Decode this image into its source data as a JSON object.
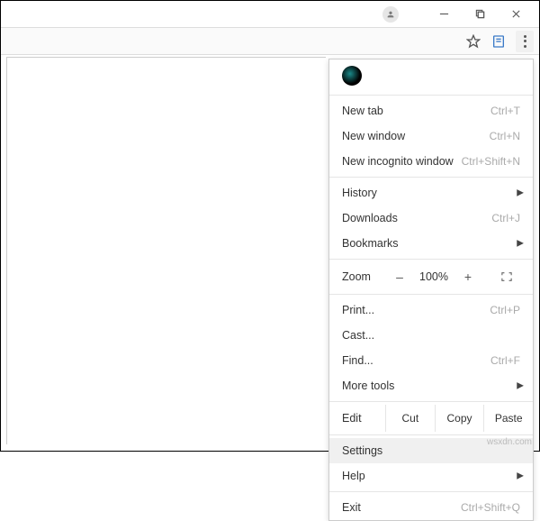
{
  "titlebar": {
    "profile_icon": "profile",
    "minimize": "—",
    "maximize": "□",
    "close": "×"
  },
  "toolbar": {
    "star_icon": "star",
    "note_icon": "note",
    "menu_icon": "kebab"
  },
  "menu": {
    "new_tab": {
      "label": "New tab",
      "shortcut": "Ctrl+T"
    },
    "new_window": {
      "label": "New window",
      "shortcut": "Ctrl+N"
    },
    "new_incognito": {
      "label": "New incognito window",
      "shortcut": "Ctrl+Shift+N"
    },
    "history": {
      "label": "History"
    },
    "downloads": {
      "label": "Downloads",
      "shortcut": "Ctrl+J"
    },
    "bookmarks": {
      "label": "Bookmarks"
    },
    "zoom": {
      "label": "Zoom",
      "minus": "–",
      "value": "100%",
      "plus": "+"
    },
    "print": {
      "label": "Print...",
      "shortcut": "Ctrl+P"
    },
    "cast": {
      "label": "Cast..."
    },
    "find": {
      "label": "Find...",
      "shortcut": "Ctrl+F"
    },
    "more_tools": {
      "label": "More tools"
    },
    "edit": {
      "label": "Edit",
      "cut": "Cut",
      "copy": "Copy",
      "paste": "Paste"
    },
    "settings": {
      "label": "Settings"
    },
    "help": {
      "label": "Help"
    },
    "exit": {
      "label": "Exit",
      "shortcut": "Ctrl+Shift+Q"
    }
  },
  "watermark": "wsxdn.com"
}
